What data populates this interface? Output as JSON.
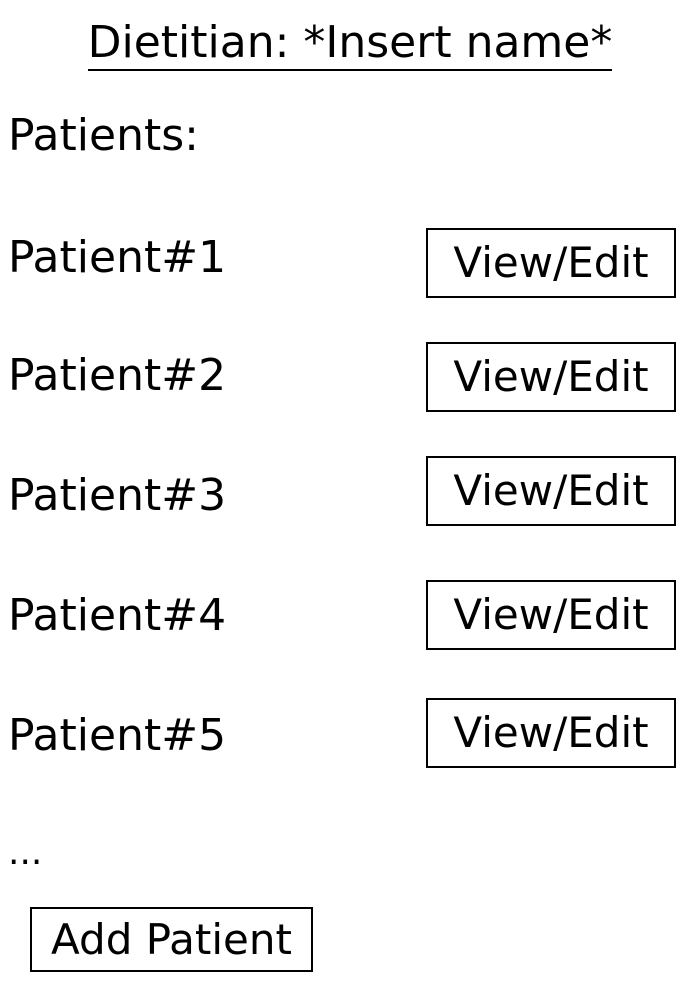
{
  "header": {
    "title": "Dietitian: *Insert name*"
  },
  "patients_section": {
    "label": "Patients:",
    "items": [
      {
        "name": "Patient#1",
        "button_label": "View/Edit"
      },
      {
        "name": "Patient#2",
        "button_label": "View/Edit"
      },
      {
        "name": "Patient#3",
        "button_label": "View/Edit"
      },
      {
        "name": "Patient#4",
        "button_label": "View/Edit"
      },
      {
        "name": "Patient#5",
        "button_label": "View/Edit"
      }
    ],
    "more_indicator": "..."
  },
  "actions": {
    "add_patient_label": "Add Patient"
  }
}
